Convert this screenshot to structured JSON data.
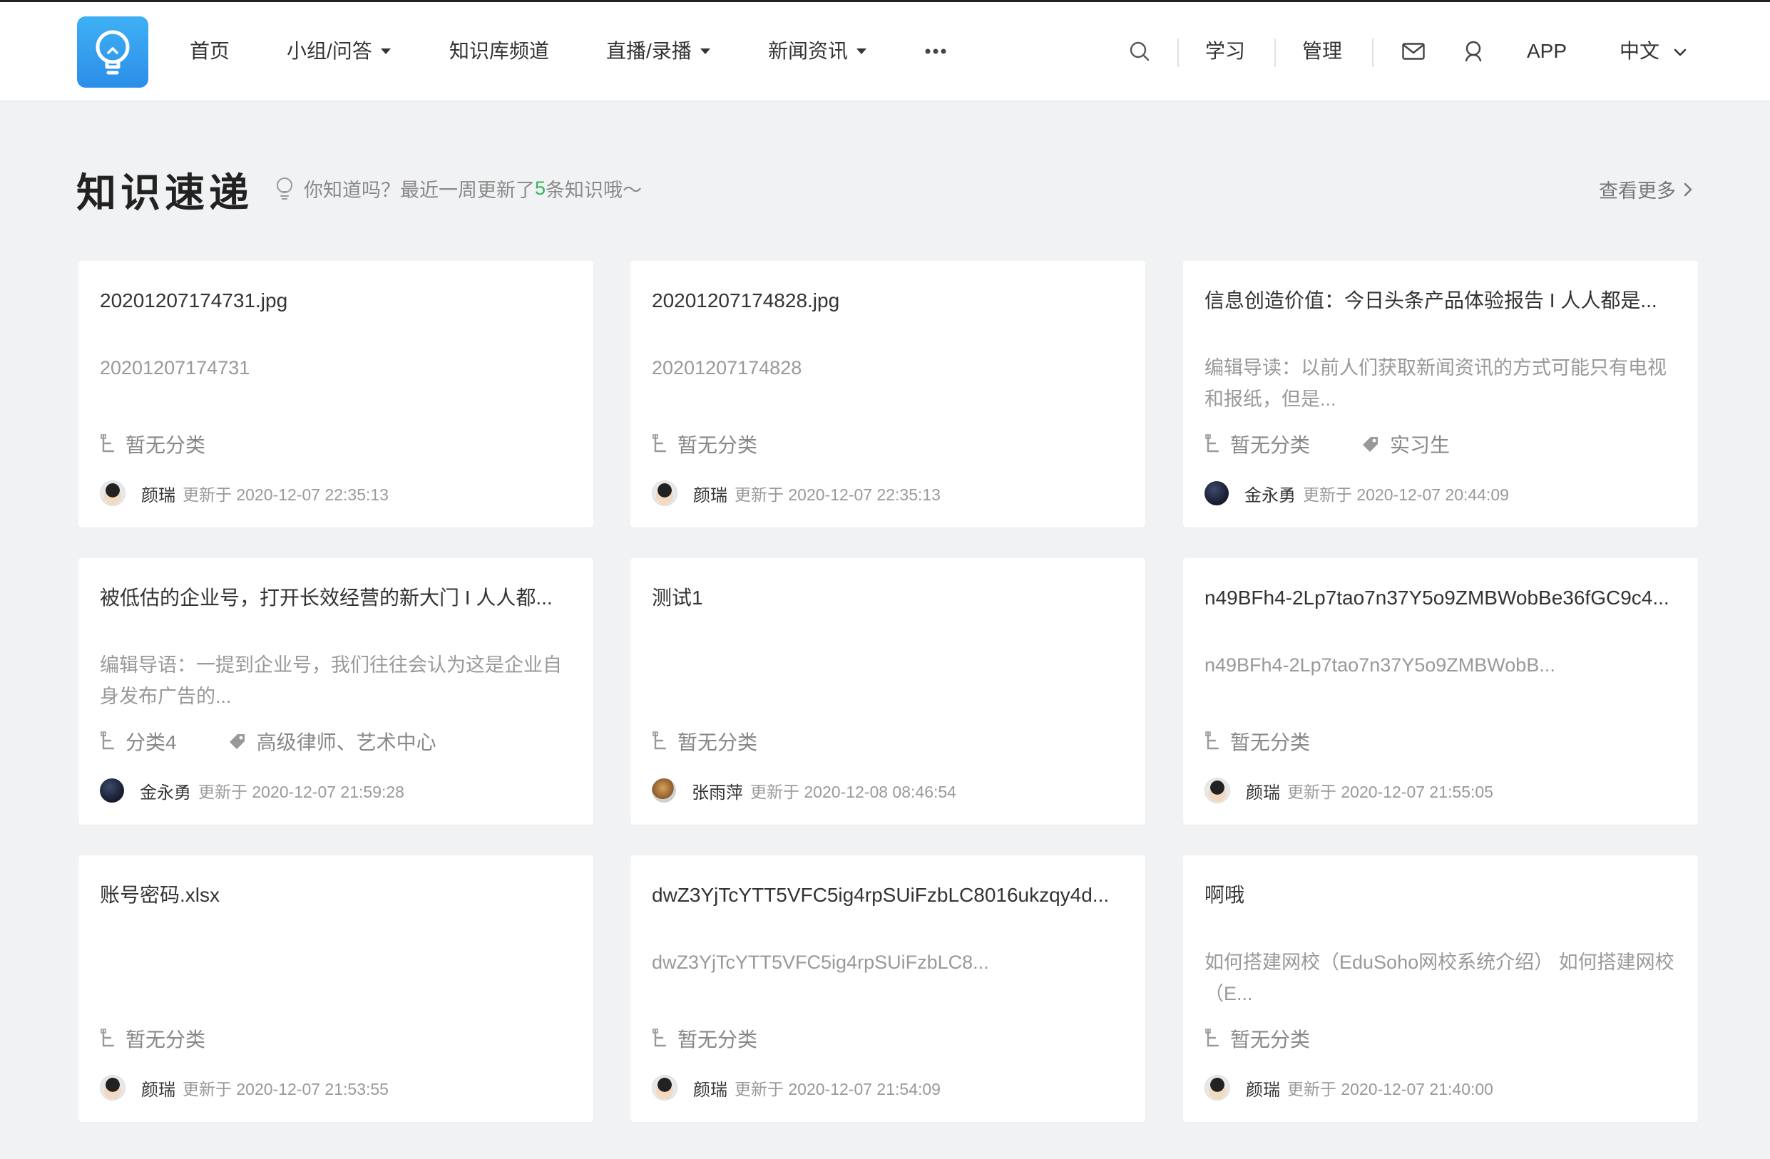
{
  "nav": {
    "items": [
      {
        "label": "首页",
        "dropdown": false
      },
      {
        "label": "小组/问答",
        "dropdown": true
      },
      {
        "label": "知识库频道",
        "dropdown": false
      },
      {
        "label": "直播/录播",
        "dropdown": true
      },
      {
        "label": "新闻资讯",
        "dropdown": true
      }
    ],
    "more_icon": "more-dots-icon",
    "right": {
      "study": "学习",
      "manage": "管理",
      "app": "APP",
      "lang": "中文"
    },
    "icons": [
      "search-icon",
      "mail-icon",
      "user-icon"
    ]
  },
  "section": {
    "title": "知识速递",
    "tip_prefix": "你知道吗？最近一周更新了",
    "tip_count": "5",
    "tip_suffix": "条知识哦～",
    "more": "查看更多"
  },
  "update_prefix": "更新于",
  "cards": [
    {
      "title": "20201207174731.jpg",
      "desc": "20201207174731",
      "category": "暂无分类",
      "tags": "",
      "author": "颜瑞",
      "avatar": "boy",
      "updated": "2020-12-07 22:35:13"
    },
    {
      "title": "20201207174828.jpg",
      "desc": "20201207174828",
      "category": "暂无分类",
      "tags": "",
      "author": "颜瑞",
      "avatar": "boy",
      "updated": "2020-12-07 22:35:13"
    },
    {
      "title": "信息创造价值：今日头条产品体验报告 I 人人都是...",
      "desc": "编辑导读：以前人们获取新闻资讯的方式可能只有电视和报纸，但是...",
      "category": "暂无分类",
      "tags": "实习生",
      "author": "金永勇",
      "avatar": "dark",
      "updated": "2020-12-07 20:44:09"
    },
    {
      "title": "被低估的企业号，打开长效经营的新大门 I 人人都...",
      "desc": "编辑导语：一提到企业号，我们往往会认为这是企业自身发布广告的...",
      "category": "分类4",
      "tags": "高级律师、艺术中心",
      "author": "金永勇",
      "avatar": "dark",
      "updated": "2020-12-07 21:59:28"
    },
    {
      "title": "测试1",
      "desc": "",
      "category": "暂无分类",
      "tags": "",
      "author": "张雨萍",
      "avatar": "photo",
      "updated": "2020-12-08 08:46:54"
    },
    {
      "title": "n49BFh4-2Lp7tao7n37Y5o9ZMBWobBe36fGC9c4...",
      "desc": "n49BFh4-2Lp7tao7n37Y5o9ZMBWobB...",
      "category": "暂无分类",
      "tags": "",
      "author": "颜瑞",
      "avatar": "boy",
      "updated": "2020-12-07 21:55:05"
    },
    {
      "title": "账号密码.xlsx",
      "desc": "",
      "category": "暂无分类",
      "tags": "",
      "author": "颜瑞",
      "avatar": "boy",
      "updated": "2020-12-07 21:53:55"
    },
    {
      "title": "dwZ3YjTcYTT5VFC5ig4rpSUiFzbLC8016ukzqy4d...",
      "desc": "dwZ3YjTcYTT5VFC5ig4rpSUiFzbLC8...",
      "category": "暂无分类",
      "tags": "",
      "author": "颜瑞",
      "avatar": "boy",
      "updated": "2020-12-07 21:54:09"
    },
    {
      "title": "啊哦",
      "desc": "如何搭建网校（EduSoho网校系统介绍） 如何搭建网校（E...",
      "category": "暂无分类",
      "tags": "",
      "author": "颜瑞",
      "avatar": "boy",
      "updated": "2020-12-07 21:40:00"
    }
  ],
  "colors": {
    "accent": "#35b558",
    "logo": "#2b8ee8",
    "background": "#f1f2f4"
  }
}
